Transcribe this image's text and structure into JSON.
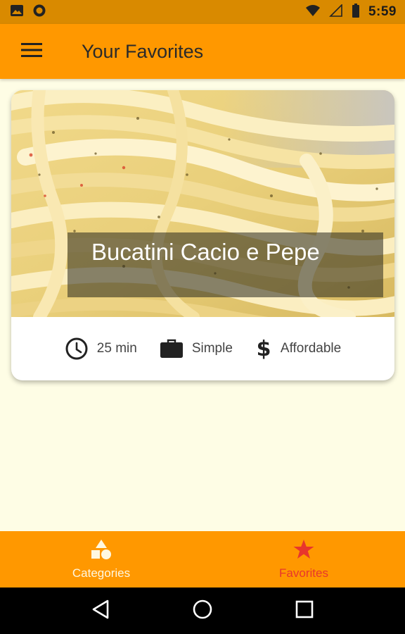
{
  "status_bar": {
    "time": "5:59",
    "icons": [
      "image-icon",
      "circle-notification-icon",
      "wifi-icon",
      "signal-icon",
      "battery-icon"
    ]
  },
  "app_bar": {
    "title": "Your Favorites",
    "menu_icon": "hamburger-menu-icon"
  },
  "meal": {
    "title": "Bucatini Cacio e Pepe",
    "duration": "25 min",
    "complexity": "Simple",
    "affordability": "Affordable",
    "icons": [
      "clock-icon",
      "briefcase-icon",
      "dollar-icon"
    ]
  },
  "bottom_nav": {
    "tabs": [
      {
        "label": "Categories",
        "icon": "category-shapes-icon",
        "active": false
      },
      {
        "label": "Favorites",
        "icon": "star-icon",
        "active": true
      }
    ]
  },
  "colors": {
    "status_bar": "#d98a00",
    "primary": "#ff9800",
    "background": "#fefde5",
    "active_tab": "#e8362c",
    "inactive_tab": "#fff8e1"
  }
}
